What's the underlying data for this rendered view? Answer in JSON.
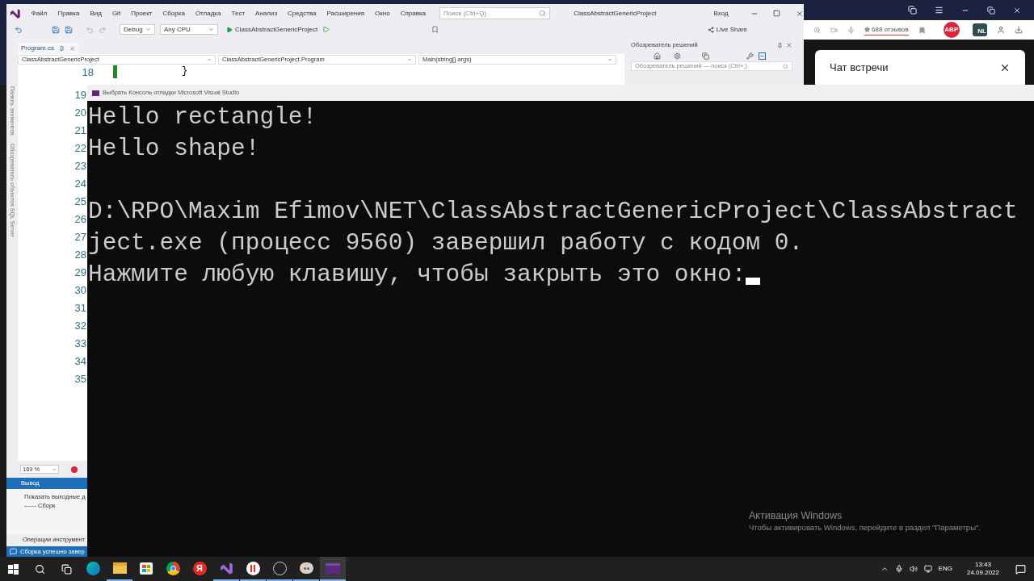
{
  "vs_window": {
    "menu": [
      "Файл",
      "Правка",
      "Вид",
      "Git",
      "Проект",
      "Сборка",
      "Отладка",
      "Тест",
      "Анализ",
      "Средства",
      "Расширения",
      "Окно",
      "Справка"
    ],
    "search": {
      "placeholder": "Поиск (Ctrl+Q)"
    },
    "title": "ClassAbstractGenericProject",
    "sign_in": "Вход",
    "toolbar": {
      "configuration": "Debug",
      "platform": "Any CPU",
      "start_target": "ClassAbstractGenericProject",
      "live_share": "Live Share"
    },
    "document_tabs": [
      {
        "label": "Program.cs",
        "selected": true
      }
    ],
    "nav_bar": [
      "ClassAbstractGenericProject",
      "ClassAbstractGenericProject.Program",
      "Main(string[] args)"
    ],
    "code_line": {
      "number": "18",
      "text": "}"
    },
    "line_numbers": [
      "19",
      "20",
      "21",
      "22",
      "23",
      "24",
      "25",
      "26",
      "27",
      "28",
      "29",
      "30",
      "31",
      "32",
      "33",
      "34",
      "35"
    ],
    "side_tabs": [
      "Панель элементов",
      "Обозреватель объектов SQL Server"
    ],
    "solution_explorer": {
      "title": "Обозреватель решений",
      "search": {
        "placeholder": "Обозреватель решений — поиск (Ctrl+;)"
      }
    },
    "zoom": "169 %",
    "output": {
      "title": "Вывод",
      "lines": [
        "Показать выходные д",
        "------ Сборк"
      ],
      "footer_tab": "Операции инструмент"
    },
    "status_bar": "Сборка успешно завер"
  },
  "browser": {
    "rating": "688 отзывов",
    "adblock": "ABP",
    "translator": "NL",
    "chat": {
      "title": "Чат встречи"
    }
  },
  "console": {
    "title": "Выбрать Консоль отладки Microsoft Visual Studio",
    "lines": [
      {
        "kind": "text",
        "text": "Hello rectangle!"
      },
      {
        "kind": "text",
        "text": "Hello shape!"
      },
      {
        "kind": "blank"
      },
      {
        "kind": "text",
        "text": "D:\\RPO\\Maxim Efimov\\NET\\ClassAbstractGenericProject\\ClassAbstract"
      },
      {
        "kind": "text",
        "text": "ject.exe (процесс 9560) завершил работу с кодом 0."
      },
      {
        "kind": "text",
        "text": "Нажмите любую клавишу, чтобы закрыть это окно:"
      }
    ],
    "cursor": true
  },
  "activation": {
    "title": "Активация Windows",
    "text": "Чтобы активировать Windows, перейдите в раздел \"Параметры\"."
  },
  "taskbar": {
    "apps": [
      {
        "kind": "edge",
        "running": false,
        "selected": false
      },
      {
        "kind": "explorer",
        "running": true,
        "selected": false
      },
      {
        "kind": "store",
        "running": false,
        "selected": false
      },
      {
        "kind": "chrome",
        "running": false,
        "selected": false
      },
      {
        "kind": "yandex",
        "label": "Я",
        "running": false,
        "selected": false
      },
      {
        "kind": "vs",
        "running": true,
        "selected": false
      },
      {
        "kind": "ybrowser",
        "running": true,
        "selected": false
      },
      {
        "kind": "obs",
        "running": true,
        "selected": false
      },
      {
        "kind": "paint",
        "running": true,
        "selected": false
      },
      {
        "kind": "terminal",
        "running": true,
        "selected": true
      }
    ],
    "language": "ENG",
    "time": "13:43",
    "date": "24.09.2022"
  }
}
